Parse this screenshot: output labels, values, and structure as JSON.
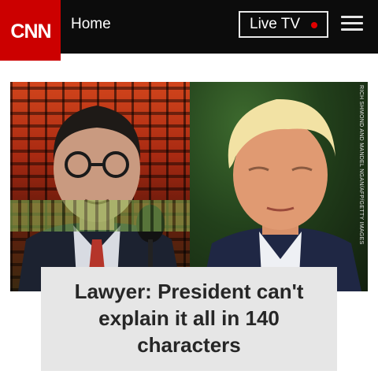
{
  "header": {
    "logo_text": "CNN",
    "home_label": "Home",
    "live_tv_label": "Live TV",
    "colors": {
      "bar": "#0c0c0c",
      "brand": "#cc0000",
      "live_dot": "#e00000"
    }
  },
  "hero": {
    "photo_credit": "RICH SHMOND AND MANDEL NGAN/AFP/GETTY IMAGES",
    "headline": "Lawyer: President can't explain it all in 140 characters"
  }
}
